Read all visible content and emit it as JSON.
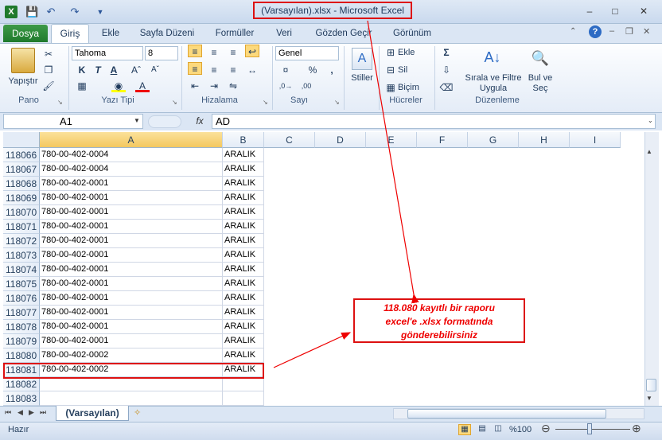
{
  "window": {
    "title": "(Varsayılan).xlsx  -  Microsoft Excel"
  },
  "tabs": [
    "Dosya",
    "Giriş",
    "Ekle",
    "Sayfa Düzeni",
    "Formüller",
    "Veri",
    "Gözden Geçir",
    "Görünüm"
  ],
  "ribbon": {
    "pano": {
      "paste": "Yapıştır",
      "group": "Pano"
    },
    "font": {
      "name": "Tahoma",
      "size": "8",
      "group": "Yazı Tipi"
    },
    "align": {
      "group": "Hizalama"
    },
    "number": {
      "format": "Genel",
      "group": "Sayı"
    },
    "styles": {
      "label": "Stiller"
    },
    "cells": {
      "insert": "Ekle",
      "delete": "Sil",
      "format": "Biçim",
      "group": "Hücreler"
    },
    "editing": {
      "sort": "Sırala ve Filtre Uygula",
      "find": "Bul ve Seç",
      "group": "Düzenleme"
    }
  },
  "formula_bar": {
    "name_box": "A1",
    "fx": "fx",
    "value": "AD"
  },
  "columns": [
    "A",
    "B",
    "C",
    "D",
    "E",
    "F",
    "G",
    "H",
    "I"
  ],
  "rows": [
    {
      "num": "118066",
      "a": "780-00-402-0004",
      "b": "ARALIK"
    },
    {
      "num": "118067",
      "a": "780-00-402-0004",
      "b": "ARALIK"
    },
    {
      "num": "118068",
      "a": "780-00-402-0001",
      "b": "ARALIK"
    },
    {
      "num": "118069",
      "a": "780-00-402-0001",
      "b": "ARALIK"
    },
    {
      "num": "118070",
      "a": "780-00-402-0001",
      "b": "ARALIK"
    },
    {
      "num": "118071",
      "a": "780-00-402-0001",
      "b": "ARALIK"
    },
    {
      "num": "118072",
      "a": "780-00-402-0001",
      "b": "ARALIK"
    },
    {
      "num": "118073",
      "a": "780-00-402-0001",
      "b": "ARALIK"
    },
    {
      "num": "118074",
      "a": "780-00-402-0001",
      "b": "ARALIK"
    },
    {
      "num": "118075",
      "a": "780-00-402-0001",
      "b": "ARALIK"
    },
    {
      "num": "118076",
      "a": "780-00-402-0001",
      "b": "ARALIK"
    },
    {
      "num": "118077",
      "a": "780-00-402-0001",
      "b": "ARALIK"
    },
    {
      "num": "118078",
      "a": "780-00-402-0001",
      "b": "ARALIK"
    },
    {
      "num": "118079",
      "a": "780-00-402-0001",
      "b": "ARALIK"
    },
    {
      "num": "118080",
      "a": "780-00-402-0002",
      "b": "ARALIK"
    },
    {
      "num": "118081",
      "a": "780-00-402-0002",
      "b": "ARALIK"
    },
    {
      "num": "118082",
      "a": "",
      "b": ""
    },
    {
      "num": "118083",
      "a": "",
      "b": ""
    }
  ],
  "sheet": {
    "tab": "(Varsayılan)"
  },
  "status": {
    "ready": "Hazır",
    "zoom": "%100"
  },
  "callout": {
    "line1": "118.080 kayıtlı bir raporu",
    "line2": "excel'e  .xlsx formatında",
    "line3": "gönderebilirsiniz"
  },
  "colors": {
    "accent": "#1f7a2c",
    "highlight": "#dd1111"
  }
}
